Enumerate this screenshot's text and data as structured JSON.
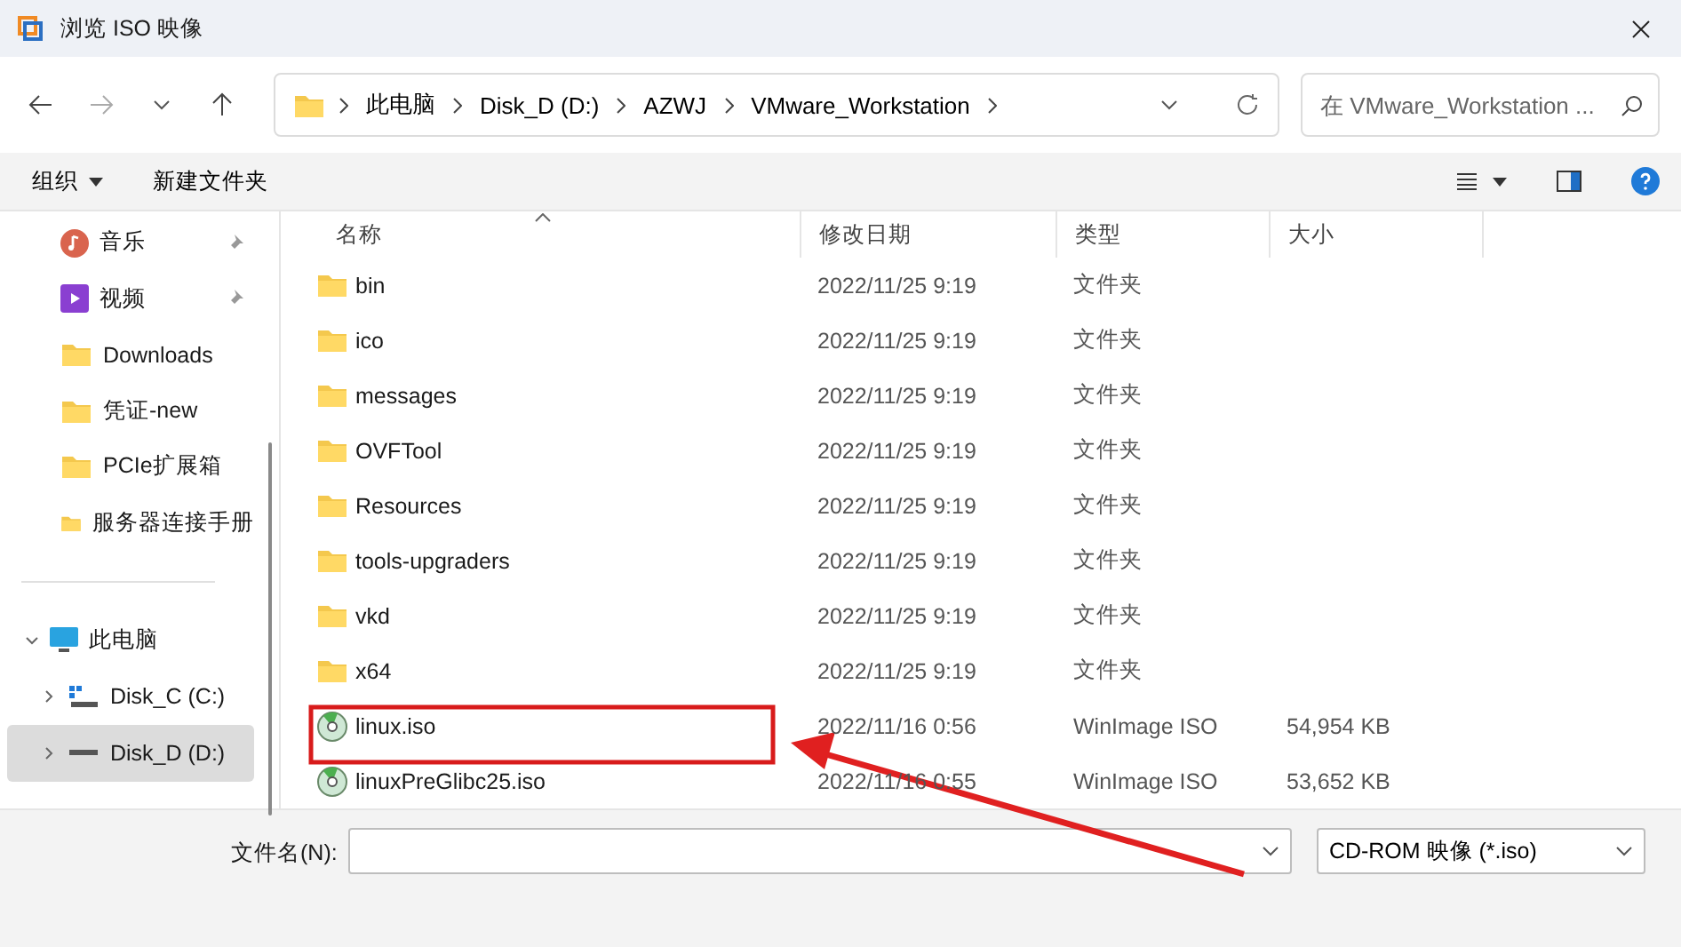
{
  "window": {
    "title": "浏览 ISO 映像"
  },
  "address": {
    "crumbs": [
      "此电脑",
      "Disk_D (D:)",
      "AZWJ",
      "VMware_Workstation"
    ],
    "search_placeholder": "在 VMware_Workstation ..."
  },
  "toolbar": {
    "organize": "组织",
    "new_folder": "新建文件夹"
  },
  "sidebar": {
    "quick": [
      {
        "label": "音乐",
        "kind": "music",
        "pinned": true
      },
      {
        "label": "视频",
        "kind": "video",
        "pinned": true
      },
      {
        "label": "Downloads",
        "kind": "folder",
        "pinned": false
      },
      {
        "label": "凭证-new",
        "kind": "folder",
        "pinned": false
      },
      {
        "label": "PCIe扩展箱",
        "kind": "folder",
        "pinned": false
      },
      {
        "label": "服务器连接手册",
        "kind": "folder",
        "pinned": false
      }
    ],
    "tree": {
      "label": "此电脑",
      "expanded": true,
      "children": [
        {
          "label": "Disk_C (C:)",
          "kind": "system",
          "selected": false,
          "expanded": false
        },
        {
          "label": "Disk_D (D:)",
          "kind": "drive",
          "selected": true,
          "expanded": false
        }
      ]
    }
  },
  "table": {
    "columns": [
      "名称",
      "修改日期",
      "类型",
      "大小"
    ],
    "rows": [
      {
        "name": "bin",
        "date": "2022/11/25 9:19",
        "type": "文件夹",
        "kind": "folder"
      },
      {
        "name": "ico",
        "date": "2022/11/25 9:19",
        "type": "文件夹",
        "kind": "folder"
      },
      {
        "name": "messages",
        "date": "2022/11/25 9:19",
        "type": "文件夹",
        "kind": "folder"
      },
      {
        "name": "OVFTool",
        "date": "2022/11/25 9:19",
        "type": "文件夹",
        "kind": "folder"
      },
      {
        "name": "Resources",
        "date": "2022/11/25 9:19",
        "type": "文件夹",
        "kind": "folder"
      },
      {
        "name": "tools-upgraders",
        "date": "2022/11/25 9:19",
        "type": "文件夹",
        "kind": "folder"
      },
      {
        "name": "vkd",
        "date": "2022/11/25 9:19",
        "type": "文件夹",
        "kind": "folder"
      },
      {
        "name": "x64",
        "date": "2022/11/25 9:19",
        "type": "文件夹",
        "kind": "folder"
      },
      {
        "name": "linux.iso",
        "date": "2022/11/16 0:56",
        "type": "WinImage ISO",
        "size": "54,954 KB",
        "kind": "disc"
      },
      {
        "name": "linuxPreGlibc25.iso",
        "date": "2022/11/16 0:55",
        "type": "WinImage ISO",
        "size": "53,652 KB",
        "kind": "disc"
      }
    ]
  },
  "footer": {
    "filename_label": "文件名(N):",
    "filter": "CD-ROM 映像 (*.iso)"
  }
}
